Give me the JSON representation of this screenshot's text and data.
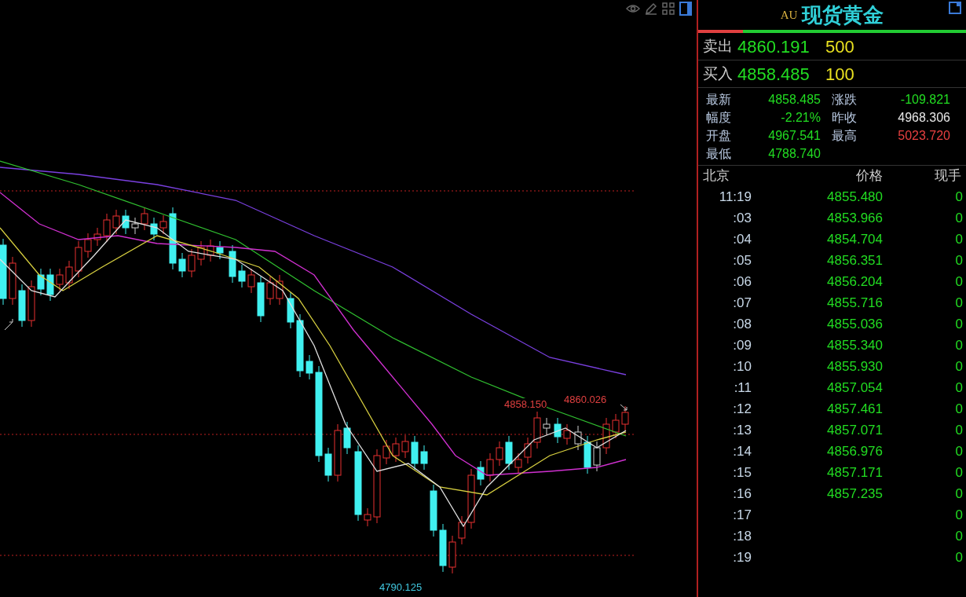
{
  "chart": {
    "annotations": [
      {
        "text": "4858.150",
        "color": "#e04040"
      },
      {
        "text": "4860.026",
        "color": "#e04040"
      },
      {
        "text": "4790.125",
        "color": "#40c8e0"
      }
    ]
  },
  "quote": {
    "code": "AU",
    "name": "现货黄金",
    "ask": {
      "label": "卖出",
      "price": "4860.191",
      "volume": "500"
    },
    "bid": {
      "label": "买入",
      "price": "4858.485",
      "volume": "100"
    },
    "stats": [
      {
        "label": "最新",
        "value": "4858.485",
        "color": "#22dd22"
      },
      {
        "label": "涨跌",
        "value": "-109.821",
        "color": "#22dd22"
      },
      {
        "label": "幅度",
        "value": "-2.21%",
        "color": "#22dd22"
      },
      {
        "label": "昨收",
        "value": "4968.306",
        "color": "#e8e8e8"
      },
      {
        "label": "开盘",
        "value": "4967.541",
        "color": "#22dd22"
      },
      {
        "label": "最高",
        "value": "5023.720",
        "color": "#e84040"
      },
      {
        "label": "最低",
        "value": "4788.740",
        "color": "#22dd22"
      }
    ]
  },
  "ticks": {
    "columns": [
      "北京",
      "价格",
      "现手"
    ],
    "rows": [
      {
        "time": "11:19",
        "price": "4855.480",
        "volume": "0"
      },
      {
        "time": ":03",
        "price": "4853.966",
        "volume": "0"
      },
      {
        "time": ":04",
        "price": "4854.704",
        "volume": "0"
      },
      {
        "time": ":05",
        "price": "4856.351",
        "volume": "0"
      },
      {
        "time": ":06",
        "price": "4856.204",
        "volume": "0"
      },
      {
        "time": ":07",
        "price": "4855.716",
        "volume": "0"
      },
      {
        "time": ":08",
        "price": "4855.036",
        "volume": "0"
      },
      {
        "time": ":09",
        "price": "4855.340",
        "volume": "0"
      },
      {
        "time": ":10",
        "price": "4855.930",
        "volume": "0"
      },
      {
        "time": ":11",
        "price": "4857.054",
        "volume": "0"
      },
      {
        "time": ":12",
        "price": "4857.461",
        "volume": "0"
      },
      {
        "time": ":13",
        "price": "4857.071",
        "volume": "0"
      },
      {
        "time": ":14",
        "price": "4856.976",
        "volume": "0"
      },
      {
        "time": ":15",
        "price": "4857.171",
        "volume": "0"
      },
      {
        "time": ":16",
        "price": "4857.235",
        "volume": "0"
      },
      {
        "time": ":17",
        "volume": "0"
      },
      {
        "time": ":18",
        "volume": "0"
      },
      {
        "time": ":19",
        "volume": "0"
      }
    ]
  }
}
